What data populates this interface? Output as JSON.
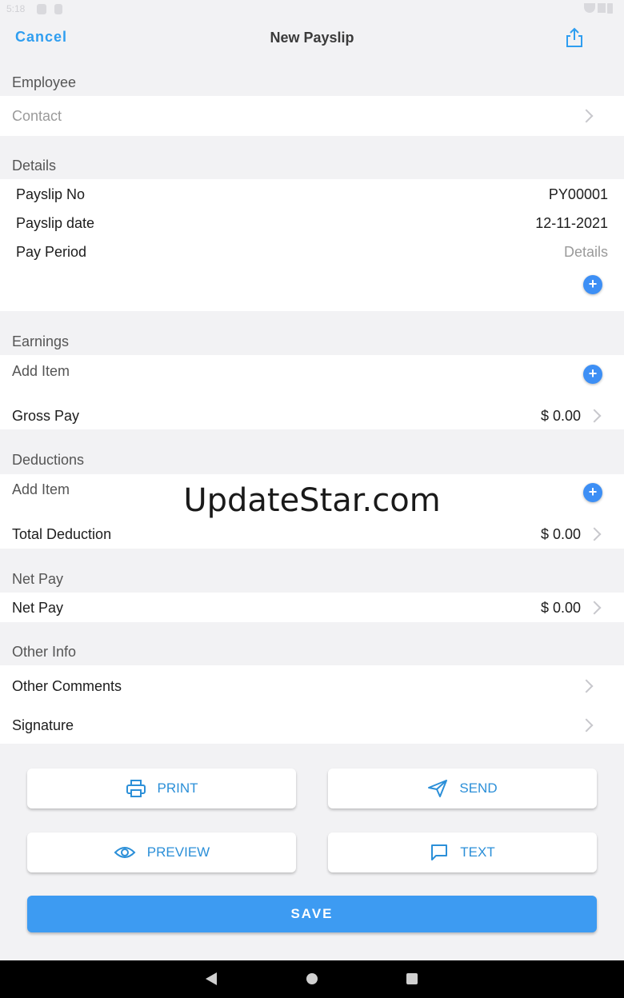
{
  "status_bar": {
    "time": "5:18"
  },
  "nav": {
    "cancel_label": "Cancel",
    "title": "New Payslip",
    "share_icon": "share-icon"
  },
  "employee": {
    "header": "Employee",
    "contact_placeholder": "Contact"
  },
  "details": {
    "header": "Details",
    "rows": [
      {
        "label": "Payslip No",
        "value": "PY00001"
      },
      {
        "label": "Payslip date",
        "value": "12-11-2021"
      },
      {
        "label": "Pay Period",
        "value": "Details"
      }
    ]
  },
  "earnings": {
    "header": "Earnings",
    "add_item": "Add Item",
    "total_label": "Gross Pay",
    "total_value": "$ 0.00"
  },
  "deductions": {
    "header": "Deductions",
    "add_item": "Add Item",
    "total_label": "Total Deduction",
    "total_value": "$ 0.00"
  },
  "net_pay": {
    "header": "Net Pay",
    "label": "Net Pay",
    "value": "$ 0.00"
  },
  "other_info": {
    "header": "Other Info",
    "comments_label": "Other Comments",
    "signature_label": "Signature"
  },
  "watermark": "UpdateStar.com",
  "actions": {
    "print": "PRINT",
    "send": "SEND",
    "preview": "PREVIEW",
    "text": "TEXT",
    "save": "SAVE"
  },
  "colors": {
    "accent": "#2f9ef0",
    "save_button": "#3d9bf2",
    "plus_button": "#3d8ff5",
    "background": "#f2f2f4"
  }
}
